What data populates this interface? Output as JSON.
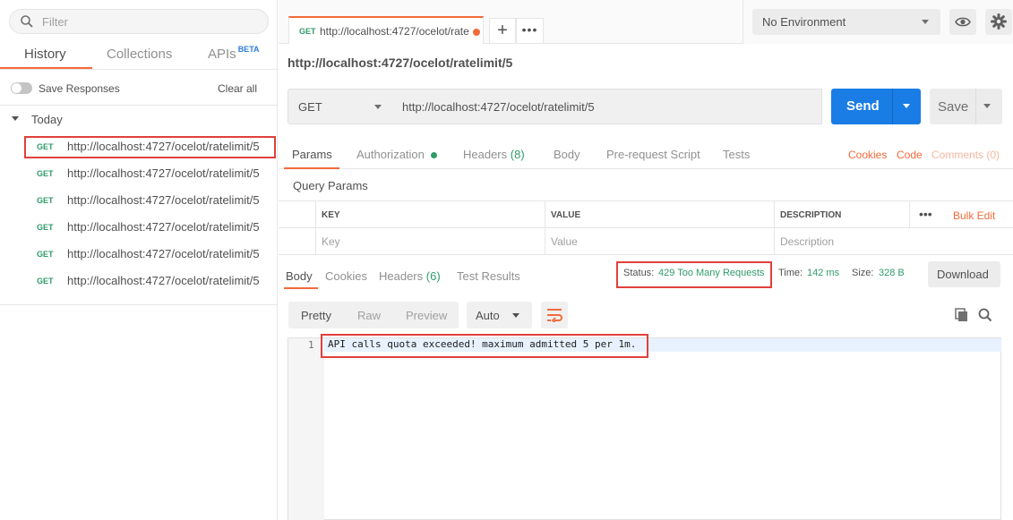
{
  "sidebar": {
    "filter_placeholder": "Filter",
    "tabs": [
      {
        "label": "History"
      },
      {
        "label": "Collections"
      },
      {
        "label": "APIs"
      }
    ],
    "beta_badge": "BETA",
    "save_responses_label": "Save Responses",
    "clear_all_label": "Clear all",
    "group_label": "Today",
    "history": [
      {
        "method": "GET",
        "url": "http://localhost:4727/ocelot/ratelimit/5"
      },
      {
        "method": "GET",
        "url": "http://localhost:4727/ocelot/ratelimit/5"
      },
      {
        "method": "GET",
        "url": "http://localhost:4727/ocelot/ratelimit/5"
      },
      {
        "method": "GET",
        "url": "http://localhost:4727/ocelot/ratelimit/5"
      },
      {
        "method": "GET",
        "url": "http://localhost:4727/ocelot/ratelimit/5"
      },
      {
        "method": "GET",
        "url": "http://localhost:4727/ocelot/ratelimit/5"
      }
    ]
  },
  "tabbar": {
    "tab_method": "GET",
    "tab_url": "http://localhost:4727/ocelot/rate",
    "plus": "+",
    "more": "•••"
  },
  "environment": {
    "selected": "No Environment"
  },
  "request": {
    "title": "http://localhost:4727/ocelot/ratelimit/5",
    "method": "GET",
    "url": "http://localhost:4727/ocelot/ratelimit/5",
    "send_label": "Send",
    "save_label": "Save",
    "tabs": {
      "params": "Params",
      "authorization": "Authorization",
      "headers": "Headers",
      "headers_count": "(8)",
      "body": "Body",
      "prerequest": "Pre-request Script",
      "tests": "Tests"
    },
    "links": {
      "cookies": "Cookies",
      "code": "Code",
      "comments": "Comments (0)"
    }
  },
  "query_params": {
    "title": "Query Params",
    "headers": {
      "key": "KEY",
      "value": "VALUE",
      "description": "DESCRIPTION"
    },
    "more": "•••",
    "bulk_edit": "Bulk Edit",
    "placeholders": {
      "key": "Key",
      "value": "Value",
      "description": "Description"
    }
  },
  "response": {
    "tabs": {
      "body": "Body",
      "cookies": "Cookies",
      "headers": "Headers",
      "headers_count": "(6)",
      "test_results": "Test Results"
    },
    "status_label": "Status:",
    "status_value": "429 Too Many Requests",
    "time_label": "Time:",
    "time_value": "142 ms",
    "size_label": "Size:",
    "size_value": "328 B",
    "download_label": "Download",
    "format_buttons": {
      "pretty": "Pretty",
      "raw": "Raw",
      "preview": "Preview"
    },
    "format_select": "Auto",
    "line_number": "1",
    "body_text": "API calls quota exceeded! maximum admitted 5 per 1m."
  },
  "colors": {
    "accent": "#f26b3a",
    "send": "#1a7de6",
    "success": "#2f9b6a",
    "highlight_box": "#e0403c"
  }
}
